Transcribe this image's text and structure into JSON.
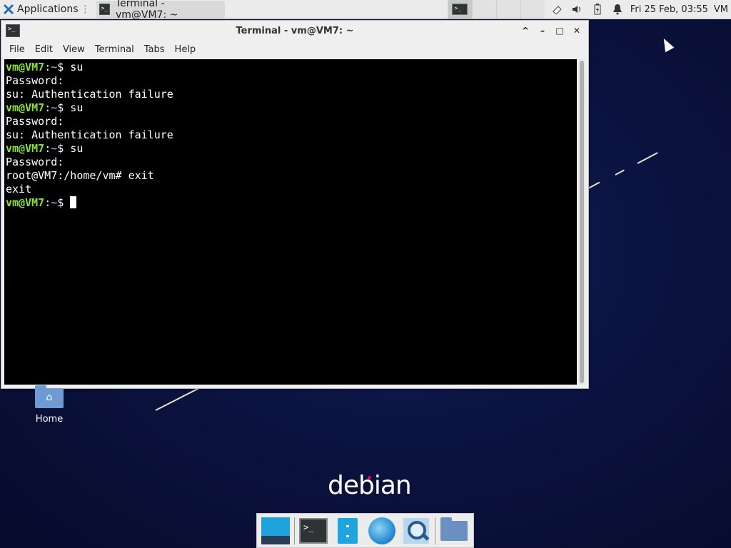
{
  "top_panel": {
    "applications_label": "Applications",
    "task_title": "Terminal - vm@VM7: ~",
    "clock": "Fri 25 Feb, 03:55",
    "user": "VM",
    "tray_icons": [
      "network-icon",
      "volume-icon",
      "battery-icon",
      "notification-bell-icon"
    ]
  },
  "window": {
    "title": "Terminal - vm@VM7: ~",
    "menu": [
      "File",
      "Edit",
      "View",
      "Terminal",
      "Tabs",
      "Help"
    ],
    "buttons": [
      "maximize-arrow",
      "minimize",
      "restore",
      "close"
    ]
  },
  "terminal": {
    "prompt_user": "vm@VM7",
    "prompt_path": "~",
    "lines": [
      {
        "type": "prompt",
        "cmd": "su"
      },
      {
        "type": "out",
        "text": "Password:"
      },
      {
        "type": "out",
        "text": "su: Authentication failure"
      },
      {
        "type": "prompt",
        "cmd": "su"
      },
      {
        "type": "out",
        "text": "Password:"
      },
      {
        "type": "out",
        "text": "su: Authentication failure"
      },
      {
        "type": "prompt",
        "cmd": "su"
      },
      {
        "type": "out",
        "text": "Password:"
      },
      {
        "type": "out",
        "text": "root@VM7:/home/vm# exit"
      },
      {
        "type": "out",
        "text": "exit"
      },
      {
        "type": "prompt",
        "cmd": "",
        "cursor": true
      }
    ]
  },
  "desktop": {
    "home_label": "Home",
    "brand": "debian"
  },
  "dock": [
    "show-desktop",
    "terminal",
    "file-manager",
    "web-browser",
    "app-finder",
    "folder"
  ]
}
